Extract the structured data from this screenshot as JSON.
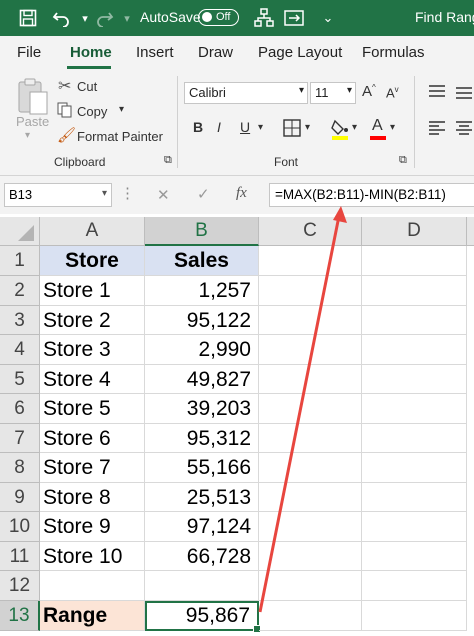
{
  "titlebar": {
    "autosave_label": "AutoSave",
    "autosave_state": "Off",
    "doc_title": "Find Range",
    "color": "#217346"
  },
  "tabs": [
    "File",
    "Home",
    "Insert",
    "Draw",
    "Page Layout",
    "Formulas"
  ],
  "ribbon": {
    "clipboard": {
      "paste": "Paste",
      "cut": "Cut",
      "copy": "Copy",
      "format_painter": "Format Painter",
      "group_label": "Clipboard"
    },
    "font": {
      "font_name": "Calibri",
      "font_size": "11",
      "bold": "B",
      "italic": "I",
      "underline": "U",
      "group_label": "Font",
      "highlight_color": "#ffff00",
      "font_color": "#ff0000"
    }
  },
  "formula_bar": {
    "name_box": "B13",
    "cancel_glyph": "✕",
    "enter_glyph": "✓",
    "fx_label": "fx",
    "formula": "=MAX(B2:B11)-MIN(B2:B11)"
  },
  "grid": {
    "columns": [
      "A",
      "B",
      "C",
      "D"
    ],
    "rows": [
      "1",
      "2",
      "3",
      "4",
      "5",
      "6",
      "7",
      "8",
      "9",
      "10",
      "11",
      "12",
      "13"
    ],
    "header": {
      "a": "Store",
      "b": "Sales"
    },
    "data": [
      {
        "a": "Store 1",
        "b": "1,257"
      },
      {
        "a": "Store 2",
        "b": "95,122"
      },
      {
        "a": "Store 3",
        "b": "2,990"
      },
      {
        "a": "Store 4",
        "b": "49,827"
      },
      {
        "a": "Store 5",
        "b": "39,203"
      },
      {
        "a": "Store 6",
        "b": "95,312"
      },
      {
        "a": "Store 7",
        "b": "55,166"
      },
      {
        "a": "Store 8",
        "b": "25,513"
      },
      {
        "a": "Store 9",
        "b": "97,124"
      },
      {
        "a": "Store 10",
        "b": "66,728"
      }
    ],
    "range_row": {
      "a": "Range",
      "b": "95,867"
    },
    "selected_cell": "B13"
  },
  "annotation": {
    "arrow_color": "#e8463f"
  }
}
